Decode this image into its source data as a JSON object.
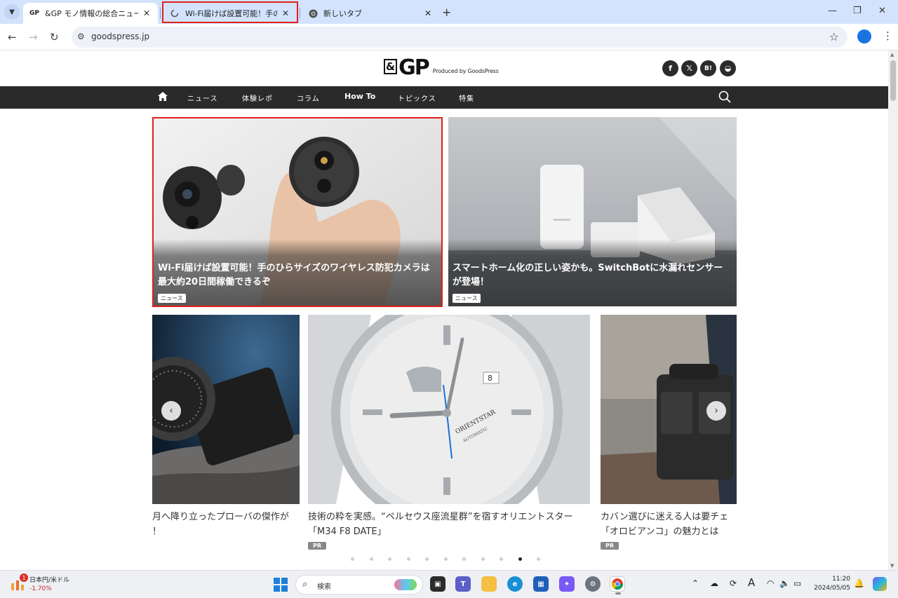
{
  "browser": {
    "tabs": [
      {
        "favicon": "GP",
        "title": "&GP モノ情報の総合ニュースサイト",
        "close": "✕"
      },
      {
        "favicon": "loading-icon",
        "title": "Wi-Fi届けば設置可能！手のひらサ",
        "close": "✕"
      },
      {
        "favicon": "chrome-icon",
        "title": "新しいタブ",
        "close": "✕"
      }
    ],
    "url": "goodspress.jp",
    "profile_initial": "👤"
  },
  "site": {
    "logo_mark": "GP",
    "logo_amp": "&",
    "tagline": "Produced by GoodsPress",
    "social": [
      "f",
      "𝕏",
      "B!",
      "◒"
    ],
    "nav": [
      "ニュース",
      "体験レポ",
      "コラム",
      "How To",
      "トピックス",
      "特集"
    ],
    "features": [
      {
        "title": "Wi-Fi届けば設置可能！手のひらサイズのワイヤレス防犯カメラは最大約20日間稼働できるぞ",
        "category": "ニュース"
      },
      {
        "title": "スマートホーム化の正しい姿かも。SwitchBotに水漏れセンサーが登場！",
        "category": "ニュース"
      }
    ],
    "carousel": [
      {
        "caption_line1": "月へ降り立ったプローバの傑作が",
        "caption_line2": "！",
        "badge": ""
      },
      {
        "caption_line1": "技術の粋を実感。“ペルセウス座流星群”を宿すオリエントスター",
        "caption_line2": "「M34 F8 DATE」",
        "badge": "PR"
      },
      {
        "caption_line1": "カバン選びに迷える人は要チェ",
        "caption_line2": "「オロビアンコ」の魅力とは",
        "badge": "PR"
      }
    ],
    "dots_total": 11,
    "dots_active": 10
  },
  "taskbar": {
    "fx_badge": "1",
    "fx_label": "日本円/米ドル",
    "fx_change": "-1.70%",
    "search_label": "検索",
    "time": "11:20",
    "date": "2024/05/05",
    "ime": "A"
  },
  "colors": {
    "highlight": "#e0201c",
    "nav_bg": "#2a2a2a",
    "tab_strip": "#d3e3fd"
  }
}
